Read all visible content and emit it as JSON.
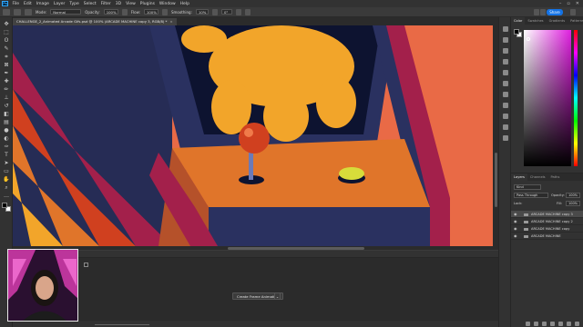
{
  "menu": {
    "logo": "Ps",
    "items": [
      "File",
      "Edit",
      "Image",
      "Layer",
      "Type",
      "Select",
      "Filter",
      "3D",
      "View",
      "Plugins",
      "Window",
      "Help"
    ]
  },
  "options": {
    "mode_label": "Mode:",
    "mode_value": "Normal",
    "opacity_label": "Opacity:",
    "opacity_value": "100%",
    "flow_label": "Flow:",
    "flow_value": "100%",
    "smoothing_label": "Smoothing:",
    "smoothing_value": "10%",
    "angle_value": "0°",
    "share_label": "Share"
  },
  "document": {
    "tab_title": "CHALLENGE_2_Animated Arcade Gifs.psd @ 100% (ARCADE MACHINE copy 3, RGB/8) *",
    "close_glyph": "×"
  },
  "color_panel": {
    "tabs": [
      "Color",
      "Swatches",
      "Gradients",
      "Patterns"
    ],
    "active_tab": "Color"
  },
  "layers_panel": {
    "tabs": [
      "Layers",
      "Channels",
      "Paths"
    ],
    "active_tab": "Layers",
    "filter_label": "Kind",
    "blend_mode": "Pass Through",
    "opacity_label": "Opacity:",
    "opacity_value": "100%",
    "lock_label": "Lock:",
    "fill_label": "Fill:",
    "fill_value": "100%",
    "layers": [
      {
        "name": "ARCADE MACHINE copy 3",
        "selected": true
      },
      {
        "name": "ARCADE MACHINE copy 2",
        "selected": false
      },
      {
        "name": "ARCADE MACHINE copy",
        "selected": false
      },
      {
        "name": "ARCADE MACHINE",
        "selected": false
      }
    ]
  },
  "timeline": {
    "create_button": "Create Frame Animation",
    "caret": "⌄"
  },
  "colors": {
    "accent": "#1473e6",
    "canvas_bg": "#e96a46",
    "flower": "#f2a52a",
    "cabinet": "#2a3160",
    "panel_orange": "#e0752a",
    "magenta_trim": "#a3204b"
  },
  "icons": {
    "toolbar": [
      "move-icon",
      "marquee-icon",
      "lasso-icon",
      "quick-select-icon",
      "crop-icon",
      "frame-icon",
      "eyedropper-icon",
      "healing-icon",
      "brush-icon",
      "stamp-icon",
      "history-brush-icon",
      "eraser-icon",
      "gradient-icon",
      "blur-icon",
      "dodge-icon",
      "pen-icon",
      "type-icon",
      "path-select-icon",
      "rectangle-icon",
      "hand-icon",
      "zoom-icon",
      "edit-toolbar-icon"
    ]
  }
}
